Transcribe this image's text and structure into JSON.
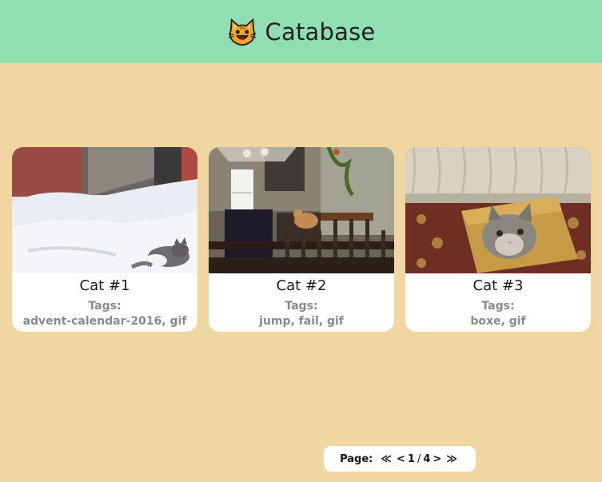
{
  "header": {
    "title": "Catabase",
    "logo_icon": "cat-face-icon"
  },
  "cards": [
    {
      "name": "Cat #1",
      "tags_label": "Tags:",
      "tags": "advent-calendar-2016, gif"
    },
    {
      "name": "Cat #2",
      "tags_label": "Tags:",
      "tags": "jump, fail, gif"
    },
    {
      "name": "Cat #3",
      "tags_label": "Tags:",
      "tags": "boxe, gif"
    }
  ],
  "pagination": {
    "label": "Page:",
    "first": "≪",
    "prev": "<",
    "current": "1",
    "separator": "/",
    "total": "4",
    "next": ">",
    "last": "≫"
  },
  "colors": {
    "background": "#f0d6a0",
    "header": "#90deb2",
    "card": "#ffffff",
    "muted_text": "#8a8a8a"
  }
}
